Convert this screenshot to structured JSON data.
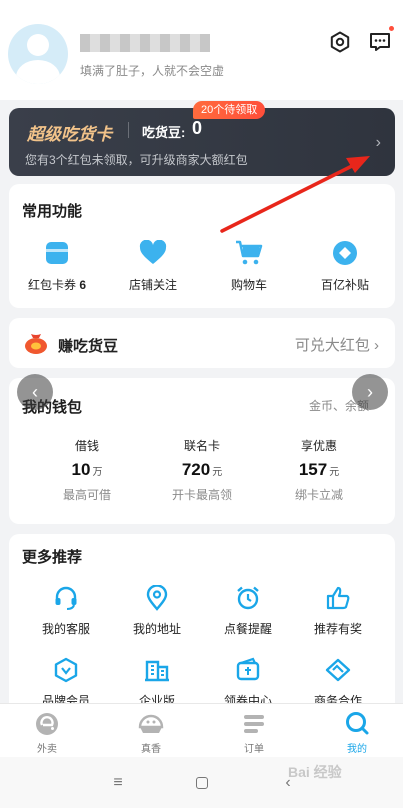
{
  "profile": {
    "slogan": "填满了肚子，人就不会空虚"
  },
  "foodie_card": {
    "title": "超级吃货卡",
    "bean_label": "吃货豆:",
    "bean_value": "0",
    "subtitle": "您有3个红包未领取，可升级商家大额红包",
    "pending_badge": "20个待领取"
  },
  "common_functions": {
    "title": "常用功能",
    "items": [
      {
        "label": "红包卡券",
        "count": "6",
        "icon": "coupon-icon"
      },
      {
        "label": "店铺关注",
        "icon": "heart-icon"
      },
      {
        "label": "购物车",
        "icon": "cart-icon"
      },
      {
        "label": "百亿补贴",
        "icon": "subsidy-icon"
      }
    ]
  },
  "earn_beans": {
    "title": "赚吃货豆",
    "right_text": "可兑大红包"
  },
  "wallet": {
    "title": "我的钱包",
    "more": "金币、余额",
    "columns": [
      {
        "title": "借钱",
        "value": "10",
        "unit": "万",
        "sub": "最高可借"
      },
      {
        "title": "联名卡",
        "value": "720",
        "unit": "元",
        "sub": "开卡最高领"
      },
      {
        "title": "享优惠",
        "value": "157",
        "unit": "元",
        "sub": "绑卡立减"
      }
    ]
  },
  "more_recommendations": {
    "title": "更多推荐",
    "items": [
      {
        "label": "我的客服",
        "icon": "headset-icon"
      },
      {
        "label": "我的地址",
        "icon": "location-icon"
      },
      {
        "label": "点餐提醒",
        "icon": "alarm-icon"
      },
      {
        "label": "推荐有奖",
        "icon": "thumbs-up-icon"
      },
      {
        "label": "品牌会员",
        "icon": "brand-member-icon"
      },
      {
        "label": "企业版",
        "icon": "enterprise-icon"
      },
      {
        "label": "领券中心",
        "icon": "coupon-center-icon"
      },
      {
        "label": "商务合作",
        "icon": "handshake-icon"
      }
    ]
  },
  "tabbar": {
    "tabs": [
      {
        "label": "外卖",
        "icon": "eleme-icon"
      },
      {
        "label": "真香",
        "icon": "bowl-icon"
      },
      {
        "label": "订单",
        "icon": "order-icon"
      },
      {
        "label": "我的",
        "icon": "user-icon",
        "active": true
      }
    ]
  },
  "colors": {
    "accent": "#1aa6e8",
    "badge": "#ff4e3a",
    "gold": "#f2c38a",
    "annotation": "#e8261b"
  },
  "watermark": "Bai 经验"
}
